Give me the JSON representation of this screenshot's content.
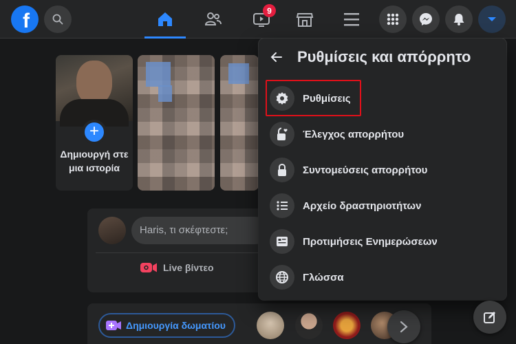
{
  "topbar": {
    "logo_letter": "f",
    "notification_badge": "9",
    "active_tab": "home",
    "icons": [
      "facebook-logo",
      "search-icon",
      "home-icon",
      "friends-icon",
      "watch-icon",
      "marketplace-icon",
      "menu-icon",
      "apps-grid-icon",
      "messenger-icon",
      "bell-icon",
      "account-caret-icon"
    ]
  },
  "stories": {
    "create_label": "Δημιουργή στε μια ιστορία"
  },
  "composer": {
    "placeholder": "Haris, τι σκέφτεστε;",
    "live_label": "Live βίντεο"
  },
  "rooms": {
    "create_room_label": "Δημιουργία δωματίου"
  },
  "dropdown": {
    "title": "Ρυθμίσεις και απόρρητο",
    "items": [
      {
        "label": "Ρυθμίσεις",
        "icon": "gear-icon"
      },
      {
        "label": "Έλεγχος απορρήτου",
        "icon": "lock-heart-icon"
      },
      {
        "label": "Συντομεύσεις απορρήτου",
        "icon": "lock-icon"
      },
      {
        "label": "Αρχείο δραστηριοτήτων",
        "icon": "list-icon"
      },
      {
        "label": "Προτιμήσεις Ενημερώσεων",
        "icon": "news-feed-icon"
      },
      {
        "label": "Γλώσσα",
        "icon": "globe-icon"
      }
    ]
  },
  "colors": {
    "background": "#18191a",
    "surface": "#242526",
    "accent": "#2d88ff",
    "badge": "#e41e3f",
    "highlight_box": "#e0101a"
  }
}
